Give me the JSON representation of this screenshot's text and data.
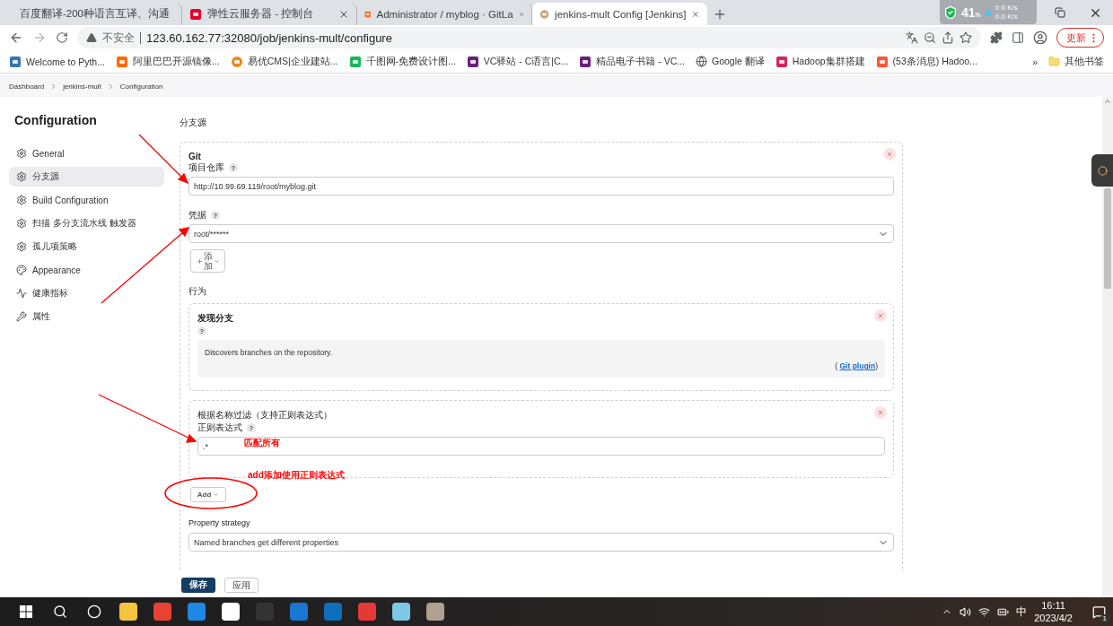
{
  "browser": {
    "tabs": [
      {
        "title": "百度翻译-200种语言互译、沟通",
        "selected": false
      },
      {
        "title": "弹性云服务器 - 控制台",
        "selected": false
      },
      {
        "title": "Administrator / myblog · GitLa",
        "selected": false
      },
      {
        "title": "jenkins-mult Config [Jenkins]",
        "selected": true
      }
    ],
    "net_monitor": {
      "percent": "41",
      "unit": "%",
      "upload": "0.0 K/s",
      "download": "0.0 K/s"
    },
    "security": "不安全",
    "url": "123.60.162.77:32080/job/jenkins-mult/configure",
    "update_button": "更新",
    "bookmarks": [
      {
        "title": "Welcome to Pyth..."
      },
      {
        "title": "阿里巴巴开源镜像..."
      },
      {
        "title": "易优CMS|企业建站..."
      },
      {
        "title": "千图网-免费设计图..."
      },
      {
        "title": "VC驿站 - C语言|C..."
      },
      {
        "title": "精品电子书籍 - VC..."
      },
      {
        "title": "Google 翻译"
      },
      {
        "title": "Hadoop集群搭建"
      },
      {
        "title": "(53条消息) Hadoo..."
      }
    ],
    "overflow": "»",
    "other_bookmarks": "其他书签"
  },
  "breadcrumb": [
    "Dashboard",
    "jenkins-mult",
    "Configuration"
  ],
  "sidebar": {
    "title": "Configuration",
    "items": [
      {
        "label": "General",
        "kind": "gear",
        "selected": false
      },
      {
        "label": "分支源",
        "kind": "gear",
        "selected": true
      },
      {
        "label": "Build Configuration",
        "kind": "gear",
        "selected": false
      },
      {
        "label": "扫描 多分支流水线 触发器",
        "kind": "gear",
        "selected": false
      },
      {
        "label": "孤儿项策略",
        "kind": "gear",
        "selected": false
      },
      {
        "label": "Appearance",
        "kind": "palette",
        "selected": false
      },
      {
        "label": "健康指标",
        "kind": "pulse",
        "selected": false
      },
      {
        "label": "属性",
        "kind": "wrench",
        "selected": false
      }
    ]
  },
  "main": {
    "section_title": "分支源",
    "git": {
      "title": "Git",
      "repo_label": "项目仓库",
      "repo_help": "?",
      "repo_value": "http://10.99.69.119/root/myblog.git",
      "credentials_label": "凭据",
      "credentials_help": "?",
      "credentials_value": "root/******",
      "add_button": "添加",
      "behaviours_label": "行为",
      "behaviours": [
        {
          "kind": "description",
          "title": "发现分支",
          "help": "?",
          "description": "Discovers branches on the repository.",
          "plugin_prefix": "(",
          "plugin_link": "Git plugin",
          "plugin_suffix": ")"
        },
        {
          "kind": "regex",
          "title": "根据名称过滤（支持正则表达式）",
          "field_label": "正则表达式",
          "help": "?",
          "value": ".*"
        }
      ],
      "add_behaviour_button": "Add",
      "property_label": "Property strategy",
      "property_value": "Named branches get different properties"
    }
  },
  "footer": {
    "save": "保存",
    "apply": "应用"
  },
  "annotations": [
    "匹配所有",
    "add添加使用正则表达式"
  ],
  "taskbar": {
    "ime": "中",
    "time": "16:11",
    "date": "2023/4/2",
    "notifications": "1"
  }
}
